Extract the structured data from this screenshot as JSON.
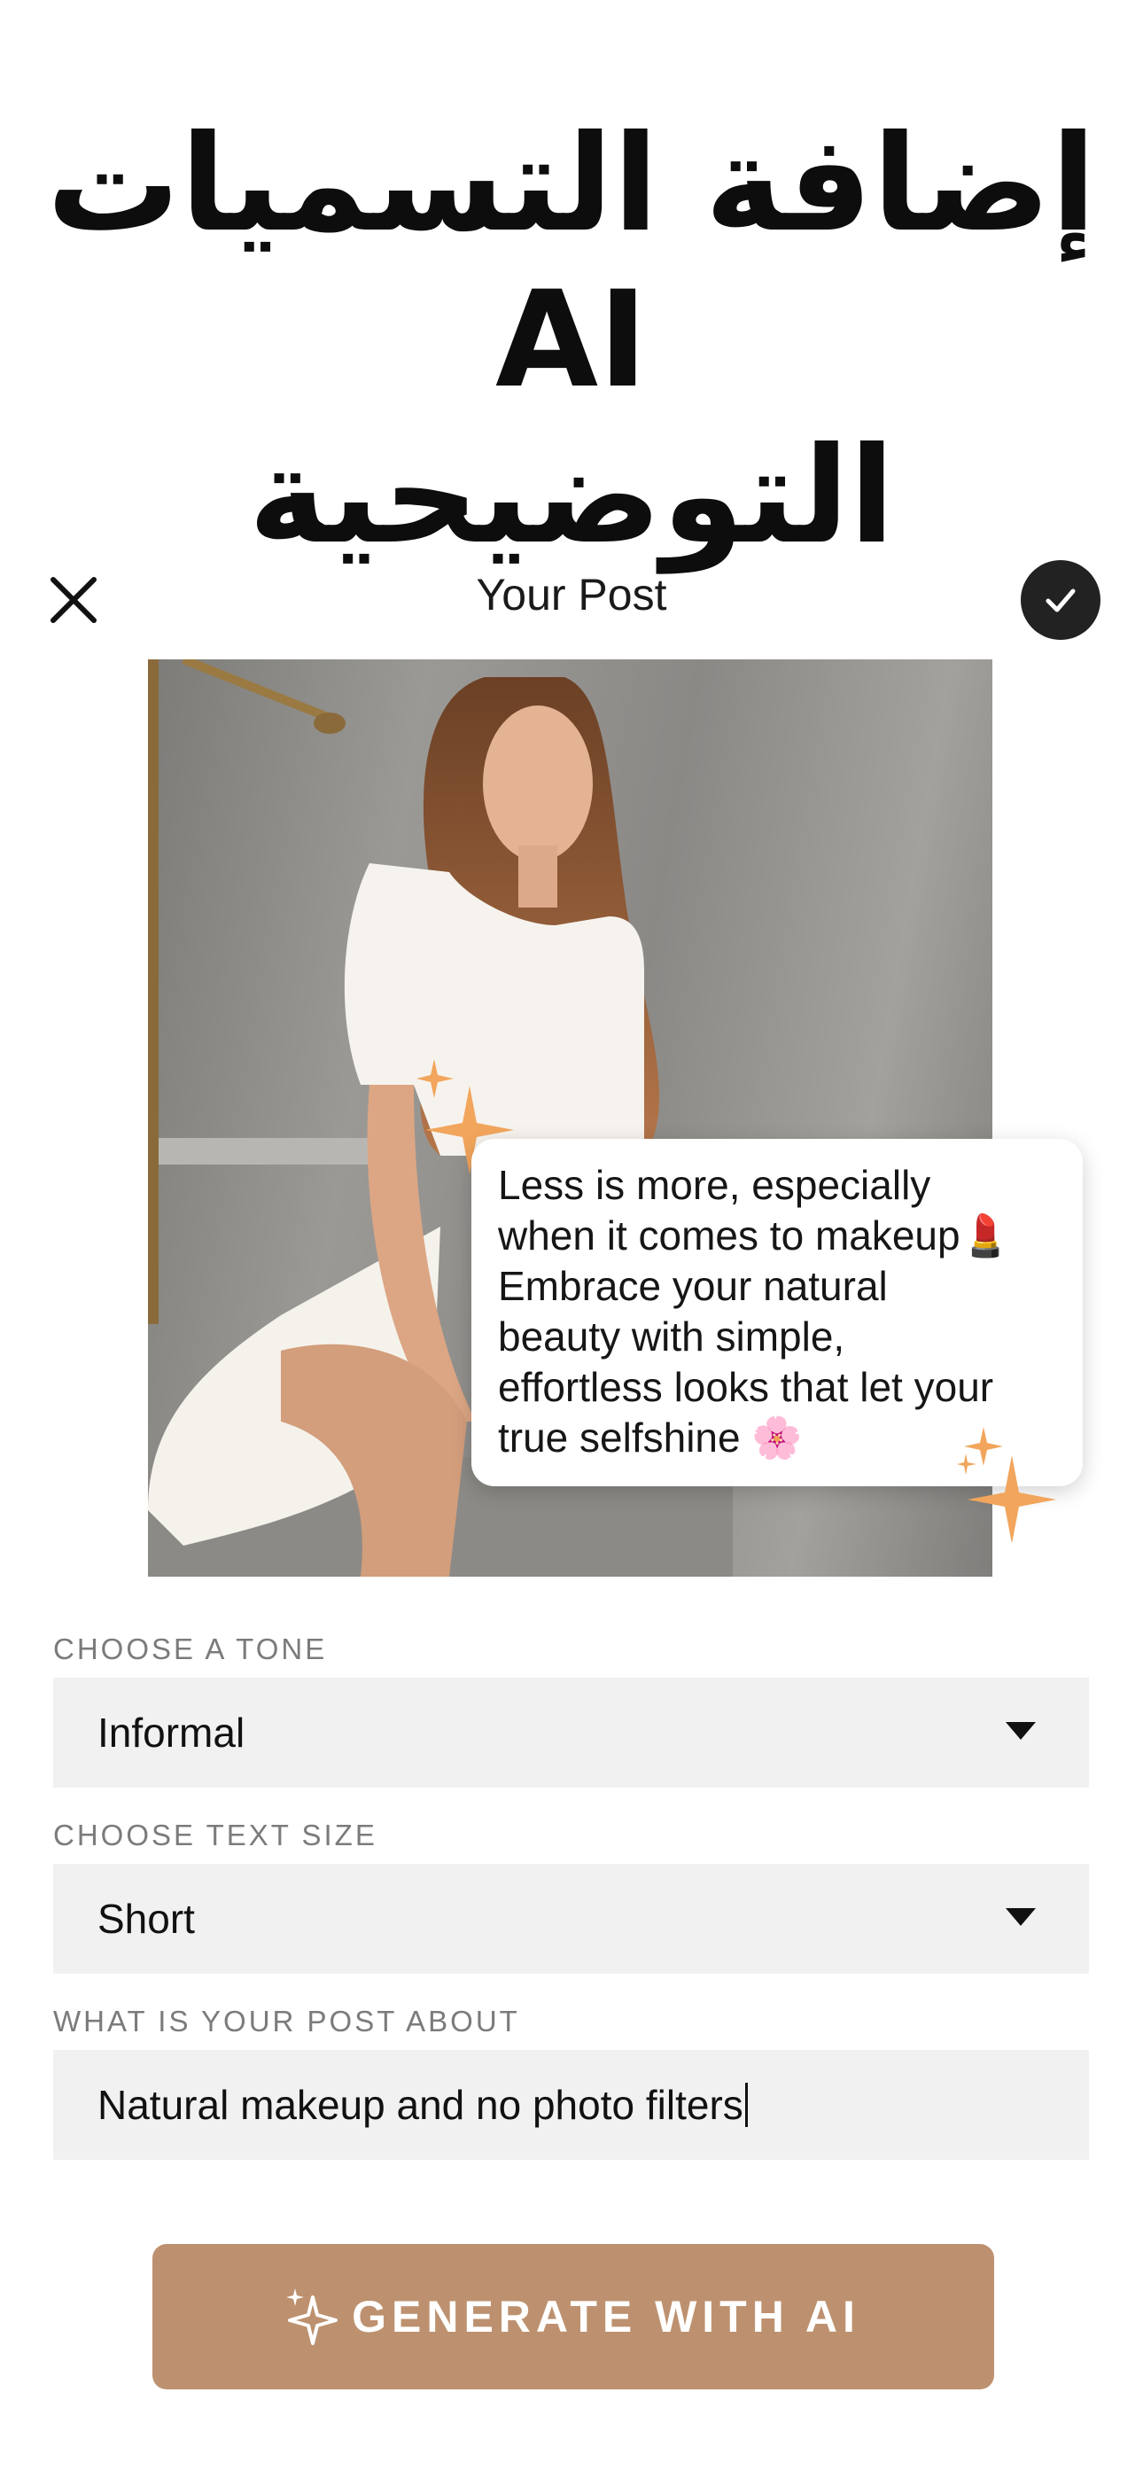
{
  "headline": {
    "line1": "إضافة التسميات AI",
    "line2": "التوضيحية"
  },
  "topbar": {
    "title": "Your Post",
    "close_icon": "close-icon",
    "confirm_icon": "checkmark-icon"
  },
  "photo": {
    "caption_lines": [
      "Less is more, especially",
      "when it comes to makeup💄",
      "Embrace your natural",
      "beauty with simple,",
      "effortless looks that let your",
      "true selfshine 🌸"
    ],
    "sparkle_icon": "sparkle-icon",
    "sparkle_color": "#f2a55c"
  },
  "form": {
    "tone_label": "CHOOSE A TONE",
    "tone_value": "Informal",
    "size_label": "CHOOSE TEXT SIZE",
    "size_value": "Short",
    "about_label": "WHAT IS YOUR POST ABOUT",
    "about_value": "Natural makeup and no photo filters"
  },
  "generate_button": {
    "label": "GENERATE WITH AI",
    "color": "#bd916f",
    "icon": "sparkle-icon"
  }
}
